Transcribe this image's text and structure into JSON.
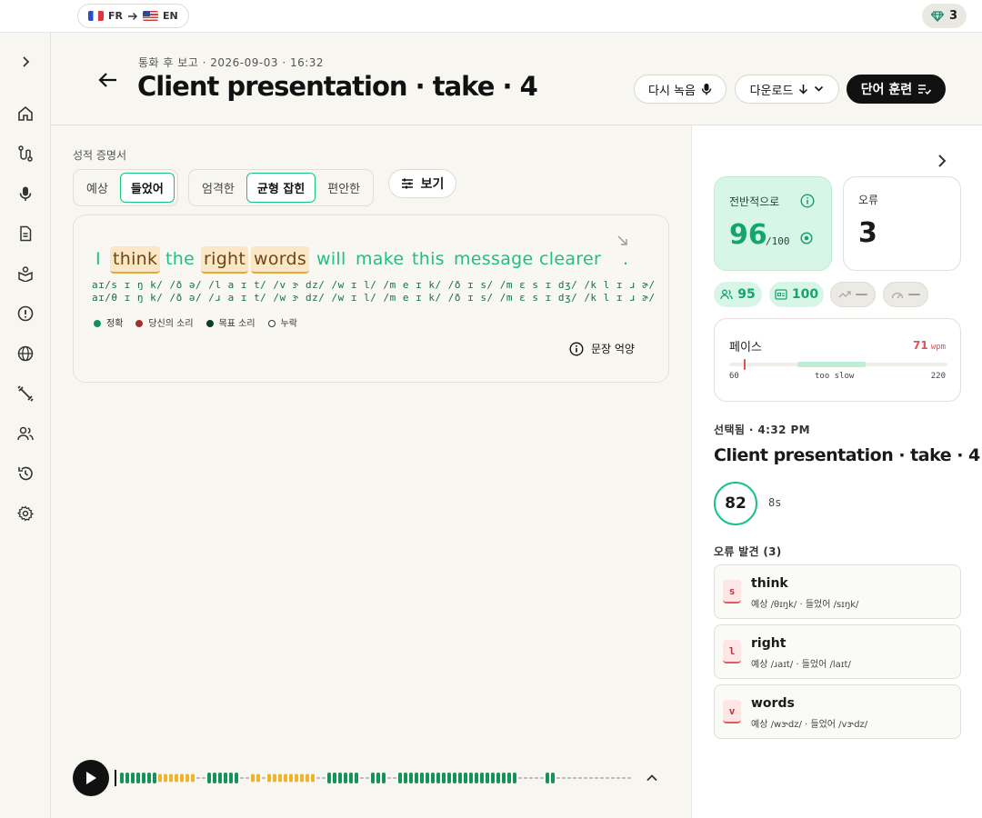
{
  "topbar": {
    "source_lang": "FR",
    "target_lang": "EN",
    "gems": "3"
  },
  "header": {
    "meta": "통화 후 보고 · 2026-09-03 · 16:32",
    "title": "Client presentation · take · 4",
    "rerecord_label": "다시 녹음",
    "download_label": "다운로드",
    "train_label": "단어 훈련"
  },
  "transcript": {
    "section_label": "성적 증명서",
    "mode_tabs": [
      "예상",
      "들었어"
    ],
    "active_mode": "들었어",
    "strictness_tabs": [
      "엄격한",
      "균형 잡힌",
      "편안한"
    ],
    "active_strictness": "균형 잡힌",
    "view_label": "보기",
    "words": [
      "I",
      "think",
      "the",
      "right",
      "words",
      "will",
      "make",
      "this",
      "message",
      "clearer",
      "."
    ],
    "ipa_expected": "aɪ/s ɪ ŋ k/ /ð ə/ /l a ɪ t/ /v ɝ dz/ /w ɪ l/ /m e ɪ k/ /ð ɪ s/  /m ɛ s ɪ dʒ/   /k l ɪ ɹ ɚ/",
    "ipa_heard": "aɪ/θ ɪ ŋ k/ /ð ə/ /ɹ a ɪ t/ /w ɝ dz/ /w ɪ l/ /m e ɪ k/ /ð ɪ s/  /m ɛ s ɪ dʒ/   /k l ɪ ɹ ɚ/",
    "legend": [
      "정확",
      "당신의 소리",
      "목표 소리",
      "누락"
    ],
    "intonation_label": "문장 억양"
  },
  "summary": {
    "overall_label": "전반적으로",
    "overall_score": "96",
    "overall_max": "/100",
    "errors_label": "오류",
    "errors_count": "3",
    "pills": [
      "95",
      "100",
      "—",
      "—"
    ],
    "pace_label": "페이스",
    "pace_value": "71",
    "pace_unit": "wpm",
    "pace_min": "60",
    "pace_note": "too slow",
    "pace_max": "220",
    "selected_label": "선택됨 · 4:32 PM",
    "selected_title": "Client presentation · take · 4",
    "selected_score": "82",
    "selected_duration": "8s",
    "errors_found_label": "오류 발견 (3)",
    "errors": [
      {
        "letter": "s",
        "word": "think",
        "detail": "예상 /θɪŋk/ · 들었어 /sɪŋk/"
      },
      {
        "letter": "l",
        "word": "right",
        "detail": "예상 /ɹaɪt/ · 들었어 /laɪt/"
      },
      {
        "letter": "v",
        "word": "words",
        "detail": "예상 /wɝdz/ · 들었어 /vɝdz/"
      }
    ]
  },
  "colors": {
    "accent": "#19c285",
    "error": "#e3a93a",
    "dark": "#111111"
  }
}
